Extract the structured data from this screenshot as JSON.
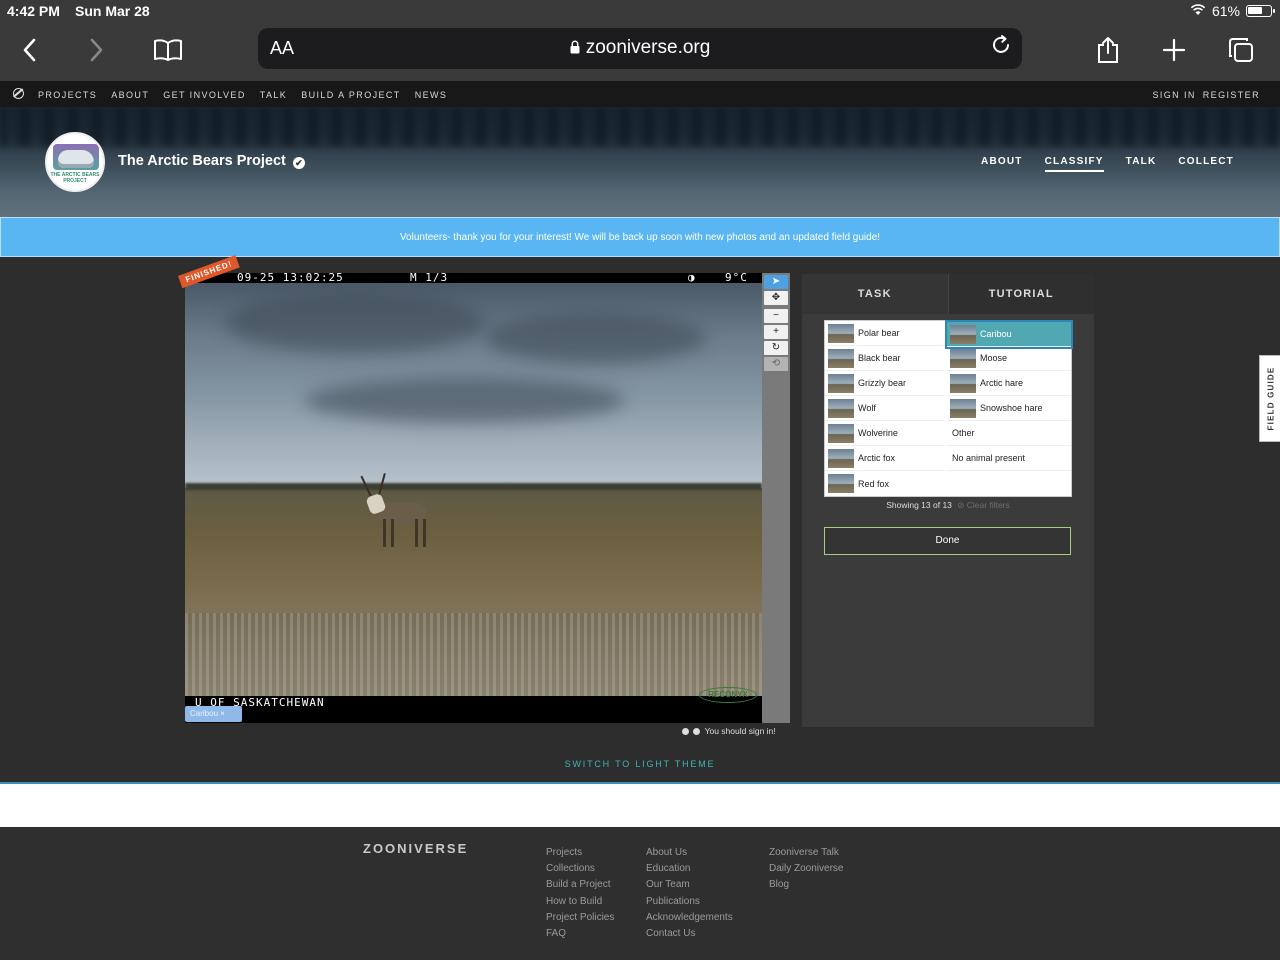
{
  "status_bar": {
    "time": "4:42 PM",
    "date": "Sun Mar 28",
    "battery": "61%"
  },
  "browser": {
    "text_size_button": "AA",
    "url": "zooniverse.org"
  },
  "site_nav": {
    "items": [
      "PROJECTS",
      "ABOUT",
      "GET INVOLVED",
      "TALK",
      "BUILD A PROJECT",
      "NEWS"
    ],
    "sign_in": "SIGN IN",
    "register": "REGISTER"
  },
  "project": {
    "avatar_text": "THE ARCTIC BEARS PROJECT",
    "title": "The Arctic Bears Project",
    "nav": [
      "ABOUT",
      "CLASSIFY",
      "TALK",
      "COLLECT"
    ],
    "active_nav": "CLASSIFY"
  },
  "announcement": "Volunteers- thank you for your interest! We will be back up soon with new photos and an updated field guide!",
  "subject": {
    "finished_badge": "FINISHED!",
    "hud_timestamp": "09-25 13:02:25",
    "hud_frame": "M 1/3",
    "hud_temp": "9°C",
    "hud_moon": "◑",
    "footer_text": "U OF SASKATCHEWAN",
    "camera_brand": "RECONYX",
    "selected_tag": "Caribou"
  },
  "sign_in_notice": "You should sign in!",
  "task_tabs": {
    "task": "TASK",
    "tutorial": "TUTORIAL"
  },
  "choices_left": [
    "Polar bear",
    "Black bear",
    "Grizzly bear",
    "Wolf",
    "Wolverine",
    "Arctic fox",
    "Red fox"
  ],
  "choices_right": [
    "Caribou",
    "Moose",
    "Arctic hare",
    "Snowshoe hare",
    "Other",
    "No animal present"
  ],
  "selected_choice": "Caribou",
  "showing": {
    "text": "Showing 13 of 13",
    "clear": "Clear filters"
  },
  "done_label": "Done",
  "field_guide": "FIELD GUIDE",
  "theme_switch": "SWITCH TO LIGHT THEME",
  "footer": {
    "brand": "ZOONIVERSE",
    "col1": [
      "Projects",
      "Collections",
      "Build a Project",
      "How to Build",
      "Project Policies",
      "FAQ"
    ],
    "col2": [
      "About Us",
      "Education",
      "Our Team",
      "Publications",
      "Acknowledgements",
      "Contact Us"
    ],
    "col3": [
      "Zooniverse Talk",
      "Daily Zooniverse",
      "Blog"
    ]
  }
}
